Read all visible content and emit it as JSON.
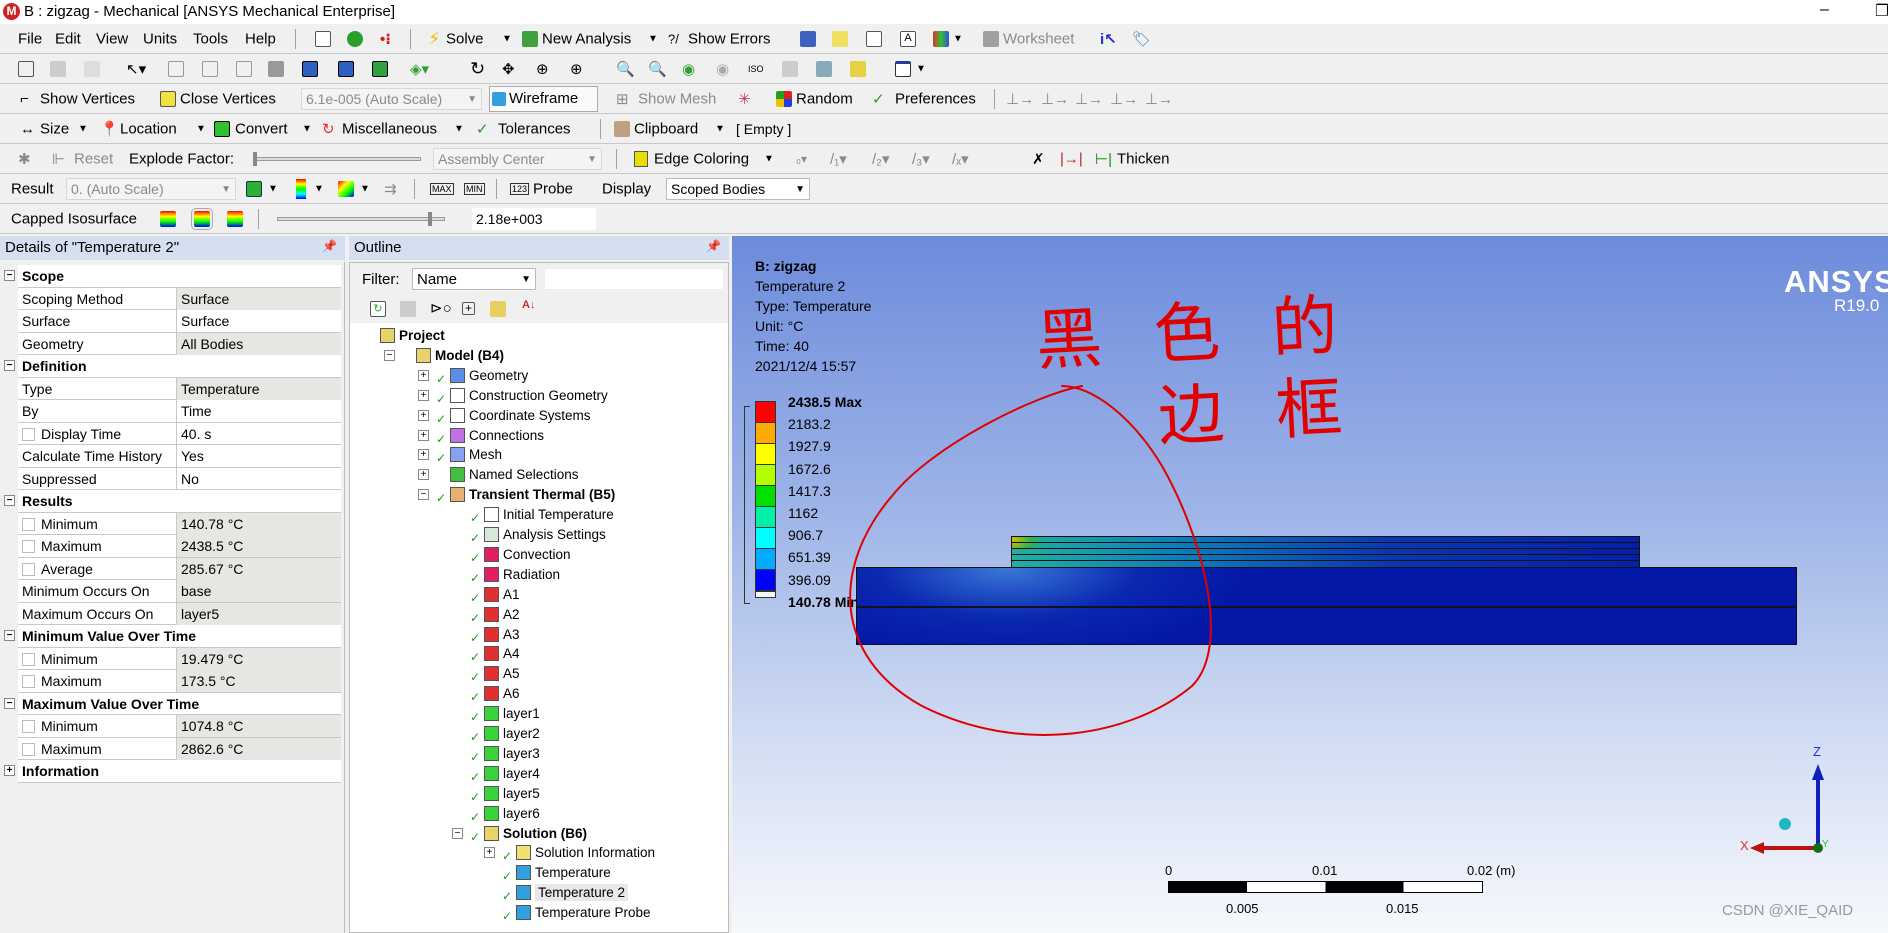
{
  "window": {
    "title": "B : zigzag - Mechanical [ANSYS Mechanical Enterprise]",
    "minimize": "–",
    "restore": "❐"
  },
  "menu": [
    "File",
    "Edit",
    "View",
    "Units",
    "Tools",
    "Help"
  ],
  "toolbar1": {
    "solve": "Solve",
    "new_analysis": "New Analysis",
    "show_errors": "Show Errors",
    "worksheet": "Worksheet"
  },
  "toolbar3": {
    "show_vertices": "Show Vertices",
    "close_vertices": "Close Vertices",
    "scale": "6.1e-005 (Auto Scale)",
    "wireframe": "Wireframe",
    "show_mesh": "Show Mesh",
    "random": "Random",
    "preferences": "Preferences"
  },
  "toolbar4": {
    "size": "Size",
    "location": "Location",
    "convert": "Convert",
    "misc": "Miscellaneous",
    "tolerances": "Tolerances",
    "clipboard": "Clipboard",
    "clipboard_state": "[ Empty ]"
  },
  "toolbar5": {
    "reset": "Reset",
    "explode_factor": "Explode Factor:",
    "assembly_center": "Assembly Center",
    "edge_coloring": "Edge Coloring",
    "thicken": "Thicken"
  },
  "toolbar6": {
    "result": "Result",
    "result_scale": "0. (Auto Scale)",
    "probe": "Probe",
    "display": "Display",
    "display_value": "Scoped Bodies"
  },
  "toolbar7": {
    "capped_isosurface": "Capped Isosurface",
    "iso_value": "2.18e+003"
  },
  "details": {
    "title": "Details of \"Temperature 2\"",
    "rows": [
      {
        "cat": true,
        "sign": "−",
        "k": "Scope"
      },
      {
        "k": "Scoping Method",
        "v": "Surface",
        "g": true
      },
      {
        "k": "Surface",
        "v": "Surface"
      },
      {
        "k": "Geometry",
        "v": "All Bodies",
        "g": true
      },
      {
        "cat": true,
        "sign": "−",
        "k": "Definition"
      },
      {
        "k": "Type",
        "v": "Temperature",
        "g": true
      },
      {
        "k": "By",
        "v": "Time"
      },
      {
        "k": "Display Time",
        "v": "40. s",
        "cb": true
      },
      {
        "k": "Calculate Time History",
        "v": "Yes"
      },
      {
        "k": "Suppressed",
        "v": "No"
      },
      {
        "cat": true,
        "sign": "−",
        "k": "Results"
      },
      {
        "k": "Minimum",
        "v": "140.78 °C",
        "cb": true,
        "g": true
      },
      {
        "k": "Maximum",
        "v": "2438.5 °C",
        "cb": true,
        "g": true
      },
      {
        "k": "Average",
        "v": "285.67 °C",
        "cb": true,
        "g": true
      },
      {
        "k": "Minimum Occurs On",
        "v": "base",
        "g": true
      },
      {
        "k": "Maximum Occurs On",
        "v": "layer5",
        "g": true
      },
      {
        "cat": true,
        "sign": "−",
        "k": "Minimum Value Over Time"
      },
      {
        "k": "Minimum",
        "v": "19.479 °C",
        "cb": true,
        "g": true
      },
      {
        "k": "Maximum",
        "v": "173.5 °C",
        "cb": true,
        "g": true
      },
      {
        "cat": true,
        "sign": "−",
        "k": "Maximum Value Over Time"
      },
      {
        "k": "Minimum",
        "v": "1074.8 °C",
        "cb": true,
        "g": true
      },
      {
        "k": "Maximum",
        "v": "2862.6 °C",
        "cb": true,
        "g": true
      },
      {
        "cat": true,
        "sign": "+",
        "k": "Information"
      }
    ]
  },
  "outline": {
    "title": "Outline",
    "filter_label": "Filter:",
    "filter_value": "Name",
    "tree": [
      {
        "label": "Project",
        "lvl": 0,
        "bold": true,
        "icon": "project-icon",
        "color": "#e8d36a"
      },
      {
        "label": "Model (B4)",
        "lvl": 1,
        "bold": true,
        "exp": "−",
        "icon": "model-icon",
        "color": "#e8d36a"
      },
      {
        "label": "Geometry",
        "lvl": 2,
        "exp": "+",
        "chk": true,
        "icon": "geometry-icon",
        "color": "#5b8ee6"
      },
      {
        "label": "Construction Geometry",
        "lvl": 2,
        "exp": "+",
        "chk": true,
        "icon": "construction-geometry-icon",
        "color": "#ffffff"
      },
      {
        "label": "Coordinate Systems",
        "lvl": 2,
        "exp": "+",
        "chk": true,
        "icon": "coordinate-systems-icon",
        "color": "#ffffff"
      },
      {
        "label": "Connections",
        "lvl": 2,
        "exp": "+",
        "chk": true,
        "icon": "connections-icon",
        "color": "#c070e0"
      },
      {
        "label": "Mesh",
        "lvl": 2,
        "exp": "+",
        "chk": true,
        "icon": "mesh-icon",
        "color": "#8aa0f0"
      },
      {
        "label": "Named Selections",
        "lvl": 2,
        "exp": "+",
        "icon": "named-selections-icon",
        "color": "#40c040"
      },
      {
        "label": "Transient Thermal (B5)",
        "lvl": 2,
        "bold": true,
        "exp": "−",
        "chk": true,
        "icon": "transient-thermal-icon",
        "color": "#e8b070"
      },
      {
        "label": "Initial Temperature",
        "lvl": 3,
        "chk": true,
        "icon": "initial-temperature-icon",
        "color": "#ffffff"
      },
      {
        "label": "Analysis Settings",
        "lvl": 3,
        "chk": true,
        "icon": "analysis-settings-icon",
        "color": "#d8e8d8"
      },
      {
        "label": "Convection",
        "lvl": 3,
        "chk": true,
        "icon": "convection-icon",
        "color": "#e02060"
      },
      {
        "label": "Radiation",
        "lvl": 3,
        "chk": true,
        "icon": "radiation-icon",
        "color": "#e02060"
      },
      {
        "label": "A1",
        "lvl": 3,
        "chk": true,
        "icon": "command-snippet-icon",
        "color": "#e03030"
      },
      {
        "label": "A2",
        "lvl": 3,
        "chk": true,
        "icon": "command-snippet-icon",
        "color": "#e03030"
      },
      {
        "label": "A3",
        "lvl": 3,
        "chk": true,
        "icon": "command-snippet-icon",
        "color": "#e03030"
      },
      {
        "label": "A4",
        "lvl": 3,
        "chk": true,
        "icon": "command-snippet-icon",
        "color": "#e03030"
      },
      {
        "label": "A5",
        "lvl": 3,
        "chk": true,
        "icon": "command-snippet-icon",
        "color": "#e03030"
      },
      {
        "label": "A6",
        "lvl": 3,
        "chk": true,
        "icon": "command-snippet-icon",
        "color": "#e03030"
      },
      {
        "label": "layer1",
        "lvl": 3,
        "chk": true,
        "icon": "element-birth-death-icon",
        "color": "#3ad23a"
      },
      {
        "label": "layer2",
        "lvl": 3,
        "chk": true,
        "icon": "element-birth-death-icon",
        "color": "#3ad23a"
      },
      {
        "label": "layer3",
        "lvl": 3,
        "chk": true,
        "icon": "element-birth-death-icon",
        "color": "#3ad23a"
      },
      {
        "label": "layer4",
        "lvl": 3,
        "chk": true,
        "icon": "element-birth-death-icon",
        "color": "#3ad23a"
      },
      {
        "label": "layer5",
        "lvl": 3,
        "chk": true,
        "icon": "element-birth-death-icon",
        "color": "#3ad23a"
      },
      {
        "label": "layer6",
        "lvl": 3,
        "chk": true,
        "icon": "element-birth-death-icon",
        "color": "#3ad23a"
      },
      {
        "label": "Solution (B6)",
        "lvl": 3,
        "bold": true,
        "exp": "−",
        "chk": true,
        "icon": "solution-icon",
        "color": "#e8d36a"
      },
      {
        "label": "Solution Information",
        "lvl": 4,
        "exp": "+",
        "chk": true,
        "icon": "solution-information-icon",
        "color": "#f0e070"
      },
      {
        "label": "Temperature",
        "lvl": 4,
        "chk": true,
        "icon": "temperature-result-icon",
        "color": "#30a0e0"
      },
      {
        "label": "Temperature 2",
        "lvl": 4,
        "chk": true,
        "selected": true,
        "icon": "temperature-result-icon",
        "color": "#30a0e0"
      },
      {
        "label": "Temperature Probe",
        "lvl": 4,
        "chk": true,
        "icon": "temperature-probe-icon",
        "color": "#30a0e0"
      }
    ]
  },
  "viewport": {
    "info": {
      "title": "B: zigzag",
      "result": "Temperature 2",
      "type": "Type: Temperature",
      "unit": "Unit: °C",
      "time": "Time: 40",
      "date": "2021/12/4 15:57"
    },
    "legend": {
      "max_label": "2438.5 Max",
      "min_label": "140.78 Min",
      "labels": [
        "2183.2",
        "1927.9",
        "1672.6",
        "1417.3",
        "1162",
        "906.7",
        "651.39",
        "396.09"
      ],
      "colors": [
        "#ff0000",
        "#ffaa00",
        "#ffff00",
        "#b2ff00",
        "#00e000",
        "#00f0a8",
        "#00ffff",
        "#00aaff",
        "#0000ff"
      ]
    },
    "brand": "ANSYS",
    "version": "R19.0",
    "scale_bar": {
      "top": [
        "0",
        "0.01",
        "0.02 (m)"
      ],
      "bottom": [
        "0.005",
        "0.015"
      ]
    },
    "triad": {
      "z": "Z",
      "x": "X",
      "y": "Y"
    },
    "annotation_handwritten": "黑色的边框",
    "watermark": "CSDN @XIE_QAID"
  }
}
